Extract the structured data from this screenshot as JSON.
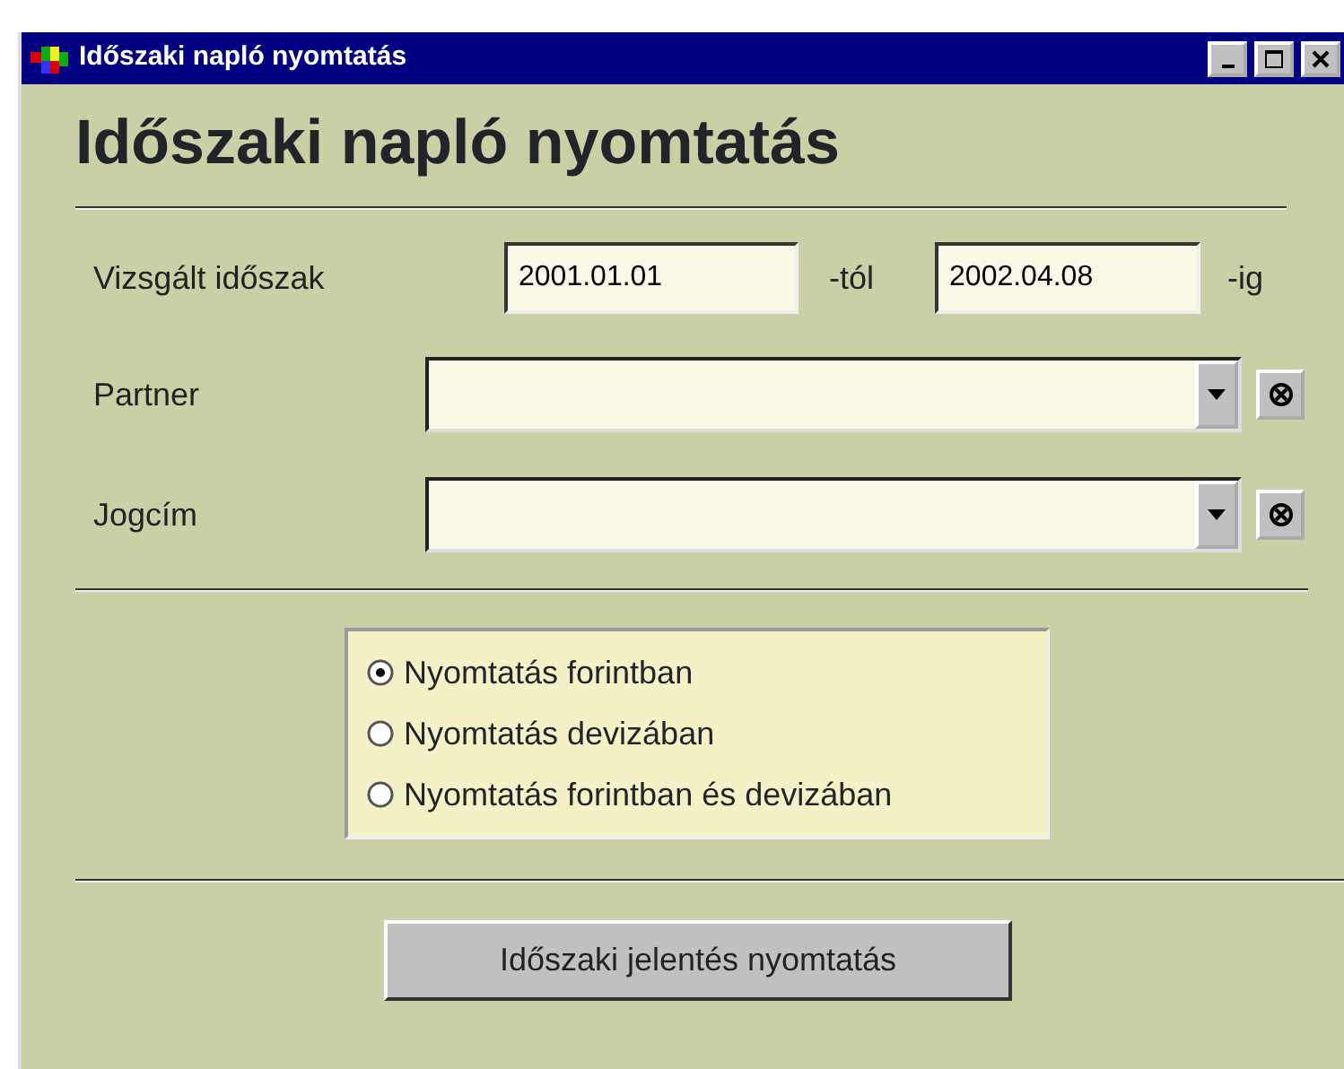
{
  "window": {
    "title": "Időszaki napló nyomtatás"
  },
  "heading": "Időszaki napló nyomtatás",
  "period": {
    "label": "Vizsgált időszak",
    "from": "2001.01.01",
    "from_suffix": "-tól",
    "to": "2002.04.08",
    "to_suffix": "-ig"
  },
  "combos": [
    {
      "label": "Partner"
    },
    {
      "label": "Jogcím"
    }
  ],
  "currency_options": [
    {
      "label": "Nyomtatás forintban",
      "selected": true
    },
    {
      "label": "Nyomtatás devizában",
      "selected": false
    },
    {
      "label": "Nyomtatás forintban és devizában",
      "selected": false
    }
  ],
  "print_button": "Időszaki jelentés nyomtatás"
}
